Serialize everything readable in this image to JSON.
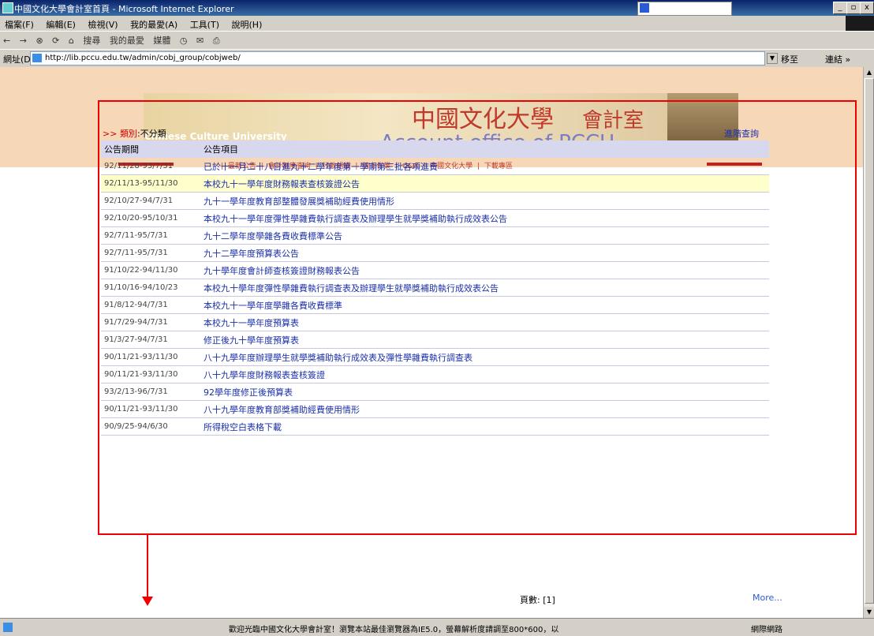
{
  "window": {
    "title": "中國文化大學會計室首頁 - Microsoft Internet Explorer",
    "controls": [
      "_",
      "▫",
      "x"
    ]
  },
  "menu": [
    "檔案(F)",
    "編輯(E)",
    "檢視(V)",
    "我的最愛(A)",
    "工具(T)",
    "說明(H)"
  ],
  "toolbar": {
    "back": "←",
    "forward": "→",
    "search": "搜尋",
    "favorites": "我的最愛",
    "media": "媒體"
  },
  "address": {
    "label": "網址(D)",
    "url": "http://lib.pccu.edu.tw/admin/cobj_group/cobjweb/",
    "go": "移至",
    "links": "連結 »"
  },
  "banner": {
    "cn_title": "中國文化大學",
    "cn_office": "會計室",
    "en_school": "Chinese Culture University",
    "en_office": "Account office of PCCU"
  },
  "nav": [
    "最新公告",
    "會計制度查詢",
    "行政組織",
    "線上作業",
    "Q&A",
    "中國文化大學",
    "下載專區"
  ],
  "breadcrumb": {
    "arrow": ">>",
    "label": "類別",
    "value": "不分類"
  },
  "advanced_search": "進階查詢",
  "table": {
    "headers": [
      "公告期間",
      "公告項目"
    ],
    "rows": [
      {
        "date": "92/11/28-93/7/31",
        "title": "已於十一月二十八日進九十二學年度第一學期第三批各項進費",
        "highlight": false
      },
      {
        "date": "92/11/13-95/11/30",
        "title": "本校九十一學年度財務報表查核簽證公告",
        "highlight": true
      },
      {
        "date": "92/10/27-94/7/31",
        "title": "九十一學年度教育部整體發展獎補助經費使用情形",
        "highlight": false
      },
      {
        "date": "92/10/20-95/10/31",
        "title": "本校九十一學年度彈性學雜費執行調查表及辦理學生就學獎補助執行成效表公告",
        "highlight": false
      },
      {
        "date": "92/7/11-95/7/31",
        "title": "九十二學年度學雜各費收費標準公告",
        "highlight": false
      },
      {
        "date": "92/7/11-95/7/31",
        "title": "九十二學年度預算表公告",
        "highlight": false
      },
      {
        "date": "91/10/22-94/11/30",
        "title": "九十學年度會計師查核簽證財務報表公告",
        "highlight": false
      },
      {
        "date": "91/10/16-94/10/23",
        "title": "本校九十學年度彈性學雜費執行調查表及辦理學生就學獎補助執行成效表公告",
        "highlight": false
      },
      {
        "date": "91/8/12-94/7/31",
        "title": "本校九十一學年度學雜各費收費標準",
        "highlight": false
      },
      {
        "date": "91/7/29-94/7/31",
        "title": "本校九十一學年度預算表",
        "highlight": false
      },
      {
        "date": "91/3/27-94/7/31",
        "title": "修正後九十學年度預算表",
        "highlight": false
      },
      {
        "date": "90/11/21-93/11/30",
        "title": "八十九學年度辦理學生就學獎補助執行成效表及彈性學雜費執行調查表",
        "highlight": false
      },
      {
        "date": "90/11/21-93/11/30",
        "title": "八十九學年度財務報表查核簽證",
        "highlight": false
      },
      {
        "date": "93/2/13-96/7/31",
        "title": "92學年度修正後預算表",
        "highlight": false
      },
      {
        "date": "90/11/21-93/11/30",
        "title": "八十九學年度教育部獎補助經費使用情形",
        "highlight": false
      },
      {
        "date": "90/9/25-94/6/30",
        "title": "所得稅空白表格下載",
        "highlight": false
      }
    ]
  },
  "pagination": {
    "label": "頁數: [1]"
  },
  "more_link": "More...",
  "status": {
    "message": "歡迎光臨中國文化大學會計室！瀏覽本站最佳瀏覽器為IE5.0，螢幕解析度請調至800*600，以",
    "zone": "網際網路"
  }
}
